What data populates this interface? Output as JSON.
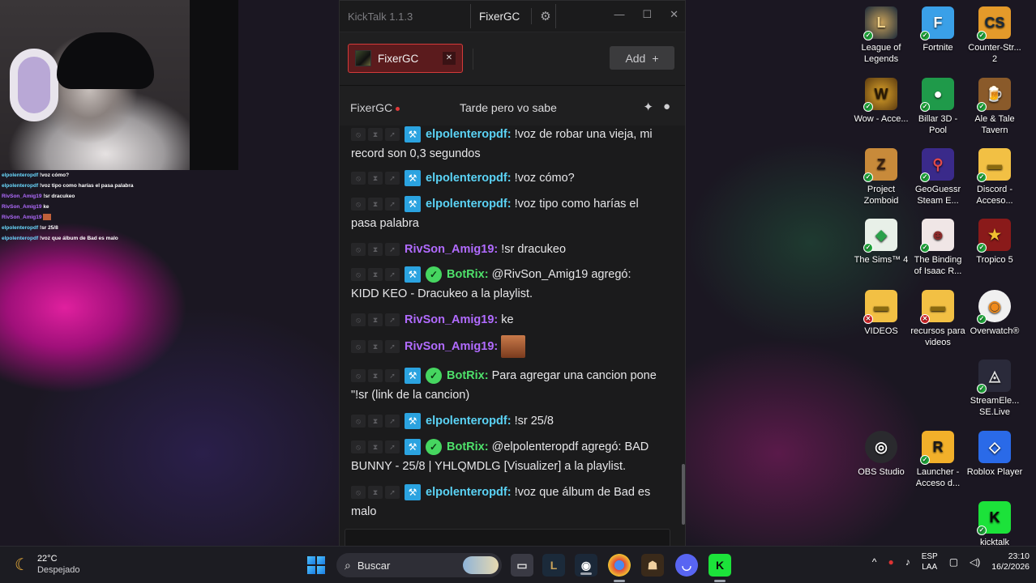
{
  "overlay_chat": [
    {
      "user": "elpolenteropdf",
      "text": "!voz cómo?",
      "color": "cyan"
    },
    {
      "user": "elpolenteropdf",
      "text": "!voz tipo como harías el pasa palabra",
      "color": "cyan"
    },
    {
      "user": "RivSon_Amig19",
      "text": "!sr dracukeo",
      "color": "purple"
    },
    {
      "user": "RivSon_Amig19",
      "text": "ke",
      "color": "purple"
    },
    {
      "user": "RivSon_Amig19",
      "text": "",
      "color": "purple"
    },
    {
      "user": "elpolenteropdf",
      "text": "!sr 25/8",
      "color": "cyan"
    },
    {
      "user": "elpolenteropdf",
      "text": "!voz que álbum de Bad es malo",
      "color": "cyan"
    }
  ],
  "kicktalk": {
    "app_title": "KickTalk 1.1.3",
    "account_name": "FixerGC",
    "tab_label": "FixerGC",
    "add_label": "Add",
    "channel_name": "FixerGC",
    "stream_title": "Tarde pero vo sabe"
  },
  "messages": [
    {
      "user": "elpolenteropdf",
      "sep": ":",
      "text": " !voz de robar una vieja, mi record son 0,3 segundos"
    },
    {
      "user": "elpolenteropdf",
      "sep": ":",
      "text": " !voz cómo?"
    },
    {
      "user": "elpolenteropdf",
      "sep": ":",
      "text": " !voz tipo como harías el pasa palabra"
    },
    {
      "user": "RivSon_Amig19",
      "sep": ":",
      "text": " !sr dracukeo"
    },
    {
      "user": "BotRix",
      "sep": ":",
      "text": " @RivSon_Amig19 agregó: KIDD KEO - Dracukeo a la playlist."
    },
    {
      "user": "RivSon_Amig19",
      "sep": ":",
      "text": " ke"
    },
    {
      "user": "RivSon_Amig19",
      "sep": ":",
      "text": ""
    },
    {
      "user": "BotRix",
      "sep": ":",
      "text": " Para agregar una cancion pone \"!sr (link de la cancion)"
    },
    {
      "user": "elpolenteropdf",
      "sep": ":",
      "text": " !sr 25/8"
    },
    {
      "user": "BotRix",
      "sep": ":",
      "text": " @elpolenteropdf agregó: BAD BUNNY - 25/8 | YHLQMDLG [Visualizer] a la playlist."
    },
    {
      "user": "elpolenteropdf",
      "sep": ":",
      "text": " !voz que álbum de Bad es malo"
    }
  ],
  "desktop_icons": [
    {
      "label": "League of Legends",
      "icon": "league-icon"
    },
    {
      "label": "Fortnite",
      "icon": "fortnite-icon"
    },
    {
      "label": "Counter-Str... 2",
      "icon": "counter-strike-icon"
    },
    {
      "label": "Wow - Acce...",
      "icon": "wow-icon"
    },
    {
      "label": "Billar 3D - Pool",
      "icon": "billar-icon"
    },
    {
      "label": "Ale & Tale Tavern",
      "icon": "ale-tale-icon"
    },
    {
      "label": "Project Zomboid",
      "icon": "zomboid-icon"
    },
    {
      "label": "GeoGuessr Steam E...",
      "icon": "geoguessr-icon"
    },
    {
      "label": "Discord - Acceso...",
      "icon": "folder-icon"
    },
    {
      "label": "The Sims™ 4",
      "icon": "sims-icon"
    },
    {
      "label": "The Binding of Isaac R...",
      "icon": "isaac-icon"
    },
    {
      "label": "Tropico 5",
      "icon": "tropico-icon"
    },
    {
      "label": "VIDEOS",
      "icon": "folder-icon"
    },
    {
      "label": "recursos para videos",
      "icon": "folder-icon"
    },
    {
      "label": "Overwatch®",
      "icon": "overwatch-icon"
    },
    {
      "label": "StreamEle... SE.Live",
      "icon": "streamelements-icon"
    },
    {
      "label": "OBS Studio",
      "icon": "obs-icon"
    },
    {
      "label": "Launcher - Acceso d...",
      "icon": "rockstar-icon"
    },
    {
      "label": "Roblox Player",
      "icon": "roblox-icon"
    },
    {
      "label": "kicktalk",
      "icon": "kick-icon"
    }
  ],
  "taskbar": {
    "temp": "22°C",
    "weather": "Despejado",
    "search": "Buscar",
    "lang1": "ESP",
    "lang2": "LAA",
    "time": "23:10",
    "date": "16/2/2026"
  }
}
